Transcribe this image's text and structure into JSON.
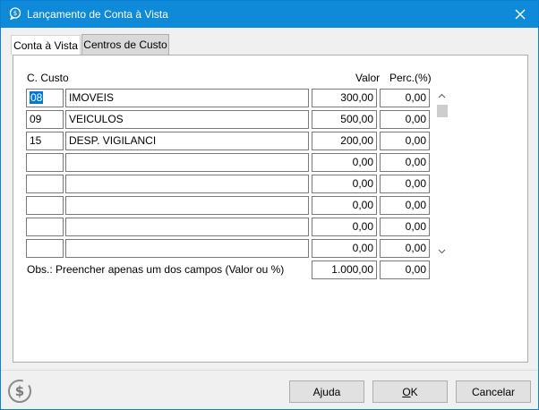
{
  "window": {
    "title": "Lançamento de Conta à Vista"
  },
  "tabs": [
    {
      "label": "Conta à Vista"
    },
    {
      "label": "Centros de Custo"
    }
  ],
  "grid": {
    "headers": {
      "custo": "C. Custo",
      "valor": "Valor",
      "perc": "Perc.(%)"
    },
    "rows": [
      {
        "code": "08",
        "name": "IMOVEIS",
        "valor": "300,00",
        "perc": "0,00"
      },
      {
        "code": "09",
        "name": "VEICULOS",
        "valor": "500,00",
        "perc": "0,00"
      },
      {
        "code": "15",
        "name": "DESP. VIGILANCI",
        "valor": "200,00",
        "perc": "0,00"
      },
      {
        "code": "",
        "name": "",
        "valor": "0,00",
        "perc": "0,00"
      },
      {
        "code": "",
        "name": "",
        "valor": "0,00",
        "perc": "0,00"
      },
      {
        "code": "",
        "name": "",
        "valor": "0,00",
        "perc": "0,00"
      },
      {
        "code": "",
        "name": "",
        "valor": "0,00",
        "perc": "0,00"
      },
      {
        "code": "",
        "name": "",
        "valor": "0,00",
        "perc": "0,00"
      }
    ]
  },
  "totals": {
    "obs": "Obs.: Preencher apenas um dos campos (Valor ou %)",
    "valor": "1.000,00",
    "perc": "0,00"
  },
  "buttons": {
    "ajuda": "Ajuda",
    "ok_first": "O",
    "ok_rest": "K",
    "cancelar": "Cancelar"
  },
  "colors": {
    "titlebar": "#0e8ad8",
    "selection": "#0078d7"
  }
}
